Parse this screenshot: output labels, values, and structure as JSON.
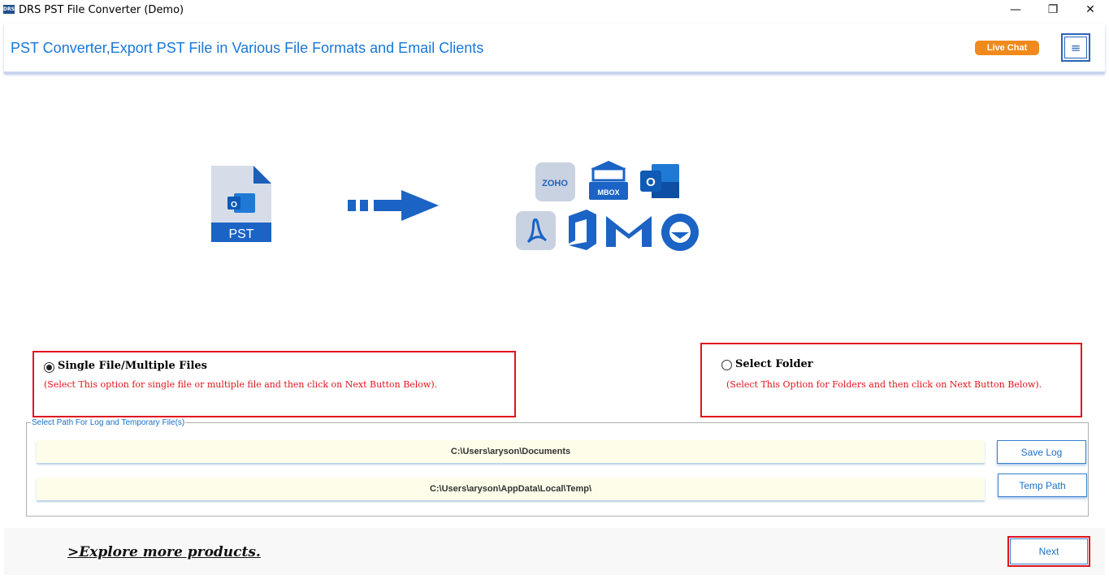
{
  "window": {
    "app_icon_text": "DRS",
    "title": "DRS PST File Converter (Demo)",
    "minimize_glyph": "—",
    "maximize_glyph": "❐",
    "close_glyph": "✕"
  },
  "header": {
    "title": "PST Converter,Export PST File in Various File Formats and Email Clients",
    "live_chat_label": "Live Chat",
    "menu_glyph": "≡"
  },
  "hero": {
    "source_label": "PST",
    "target_icons": [
      {
        "name": "zoho-icon",
        "label": "ZOHO"
      },
      {
        "name": "mbox-icon",
        "label": "MBOX"
      },
      {
        "name": "outlook-icon",
        "label": "O"
      },
      {
        "name": "pdf-icon"
      },
      {
        "name": "office365-icon"
      },
      {
        "name": "gmail-icon"
      },
      {
        "name": "thunderbird-icon"
      }
    ]
  },
  "options": {
    "single": {
      "label": "Single File/Multiple Files",
      "description": "(Select This option for single file or multiple file and then click on Next Button Below).",
      "selected": true
    },
    "folder": {
      "label": "Select Folder",
      "description": "(Select This Option for Folders and then click on Next Button Below).",
      "selected": false
    }
  },
  "paths": {
    "legend": "Select Path For Log and Temporary File(s)",
    "log_path": "C:\\Users\\aryson\\Documents",
    "temp_path": "C:\\Users\\aryson\\AppData\\Local\\Temp\\",
    "save_log_label": "Save Log",
    "temp_path_label": "Temp Path"
  },
  "footer": {
    "explore_label": ">Explore more products.",
    "next_label": "Next"
  },
  "colors": {
    "accent_blue": "#1878d8",
    "live_chat_orange": "#f08a1c",
    "highlight_red": "#e0141c"
  }
}
